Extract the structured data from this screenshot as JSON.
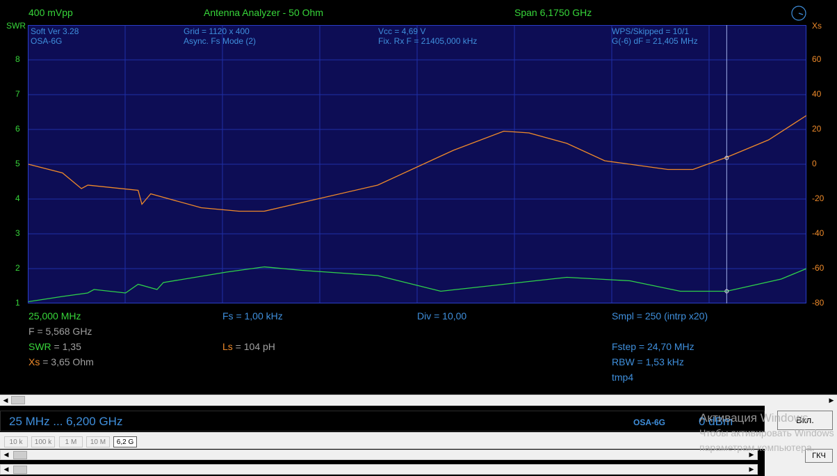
{
  "header": {
    "amplitude": "400 mVpp",
    "title": "Antenna Analyzer - 50 Ohm",
    "span": "Span 6,1750 GHz"
  },
  "axes": {
    "left_label": "SWR",
    "right_label": "Xs",
    "left_ticks": [
      "8",
      "7",
      "6",
      "5",
      "4",
      "3",
      "2",
      "1"
    ],
    "right_ticks": [
      "60",
      "40",
      "20",
      "0",
      "-20",
      "-40",
      "-60",
      "-80"
    ]
  },
  "info": {
    "soft_ver": "Soft Ver 3.28",
    "device": "OSA-6G",
    "grid": "Grid = 1120 x 400",
    "fs_mode": "Async. Fs Mode (2)",
    "vcc": "Vcc = 4,69 V",
    "rx_f": "Fix. Rx F = 21405,000 kHz",
    "wps": "WPS/Skipped  = 10/1",
    "gdf": "G(-6) dF = 21,405 MHz"
  },
  "readouts": {
    "start_freq": "25,000 MHz",
    "fs": "Fs = 1,00 kHz",
    "div": "Div = 10,00",
    "smpl": "Smpl = 250 (intrp x20)",
    "f": "F = 5,568 GHz",
    "swr_label": "SWR",
    "swr_value": " = 1,35",
    "ls_label": "Ls",
    "ls_value": " = 104 pH",
    "fstep": "Fstep = 24,70 MHz",
    "xs_label": "Xs",
    "xs_value": " = 3,65 Ohm",
    "rbw": "RBW = 1,53 kHz",
    "file": "tmp4"
  },
  "status": {
    "range": "25 MHz  ...  6,200 GHz",
    "device": "OSA-6G",
    "level": "0 dBm"
  },
  "buttons": {
    "vkl": "Вкл.",
    "gkch": "ГКЧ",
    "ranges": [
      "10 k",
      "100 k",
      "1 M",
      "10 M",
      "6,2 G"
    ]
  },
  "watermark": {
    "line1": "Активация Windows",
    "line2": "Чтобы активировать Windows",
    "line3": "параметрам компьютера."
  },
  "colors": {
    "swr_trace": "#2fd24a",
    "xs_trace": "#f08a2a",
    "plot_bg": "#0d0d55",
    "grid": "#1e2ea8",
    "text_blue": "#3f8fdc",
    "text_green": "#37d63a"
  },
  "chart_data": {
    "type": "line",
    "title": "Antenna Analyzer - 50 Ohm",
    "xlabel": "",
    "x_range": [
      0.025,
      6.2
    ],
    "y_left": {
      "label": "SWR",
      "ylim": [
        1,
        9
      ]
    },
    "y_right": {
      "label": "Xs",
      "ylim": [
        -80,
        80
      ]
    },
    "grid": true,
    "marker": {
      "freq_ghz": 5.568,
      "swr": 1.35,
      "xs": 3.65
    },
    "series": [
      {
        "axis": "left",
        "x": [
          0.03,
          0.3,
          0.5,
          0.55,
          0.8,
          0.9,
          1.05,
          1.1,
          1.6,
          1.9,
          2.2,
          2.8,
          3.3,
          3.8,
          4.3,
          4.8,
          5.2,
          5.568,
          6.0,
          6.2
        ],
        "y": [
          1.05,
          1.2,
          1.3,
          1.4,
          1.3,
          1.55,
          1.4,
          1.6,
          1.9,
          2.05,
          1.95,
          1.8,
          1.35,
          1.55,
          1.75,
          1.65,
          1.35,
          1.35,
          1.7,
          2.0
        ]
      },
      {
        "axis": "right",
        "x": [
          0.03,
          0.3,
          0.45,
          0.5,
          0.9,
          0.93,
          1.0,
          1.4,
          1.7,
          1.9,
          2.2,
          2.8,
          3.4,
          3.8,
          4.0,
          4.3,
          4.6,
          5.1,
          5.3,
          5.568,
          5.9,
          6.2
        ],
        "y": [
          0,
          -5,
          -14,
          -12,
          -15,
          -23,
          -17,
          -25,
          -27,
          -27,
          -22,
          -12,
          8,
          19,
          18,
          12,
          2,
          -3,
          -3,
          4,
          14,
          28
        ]
      }
    ]
  }
}
